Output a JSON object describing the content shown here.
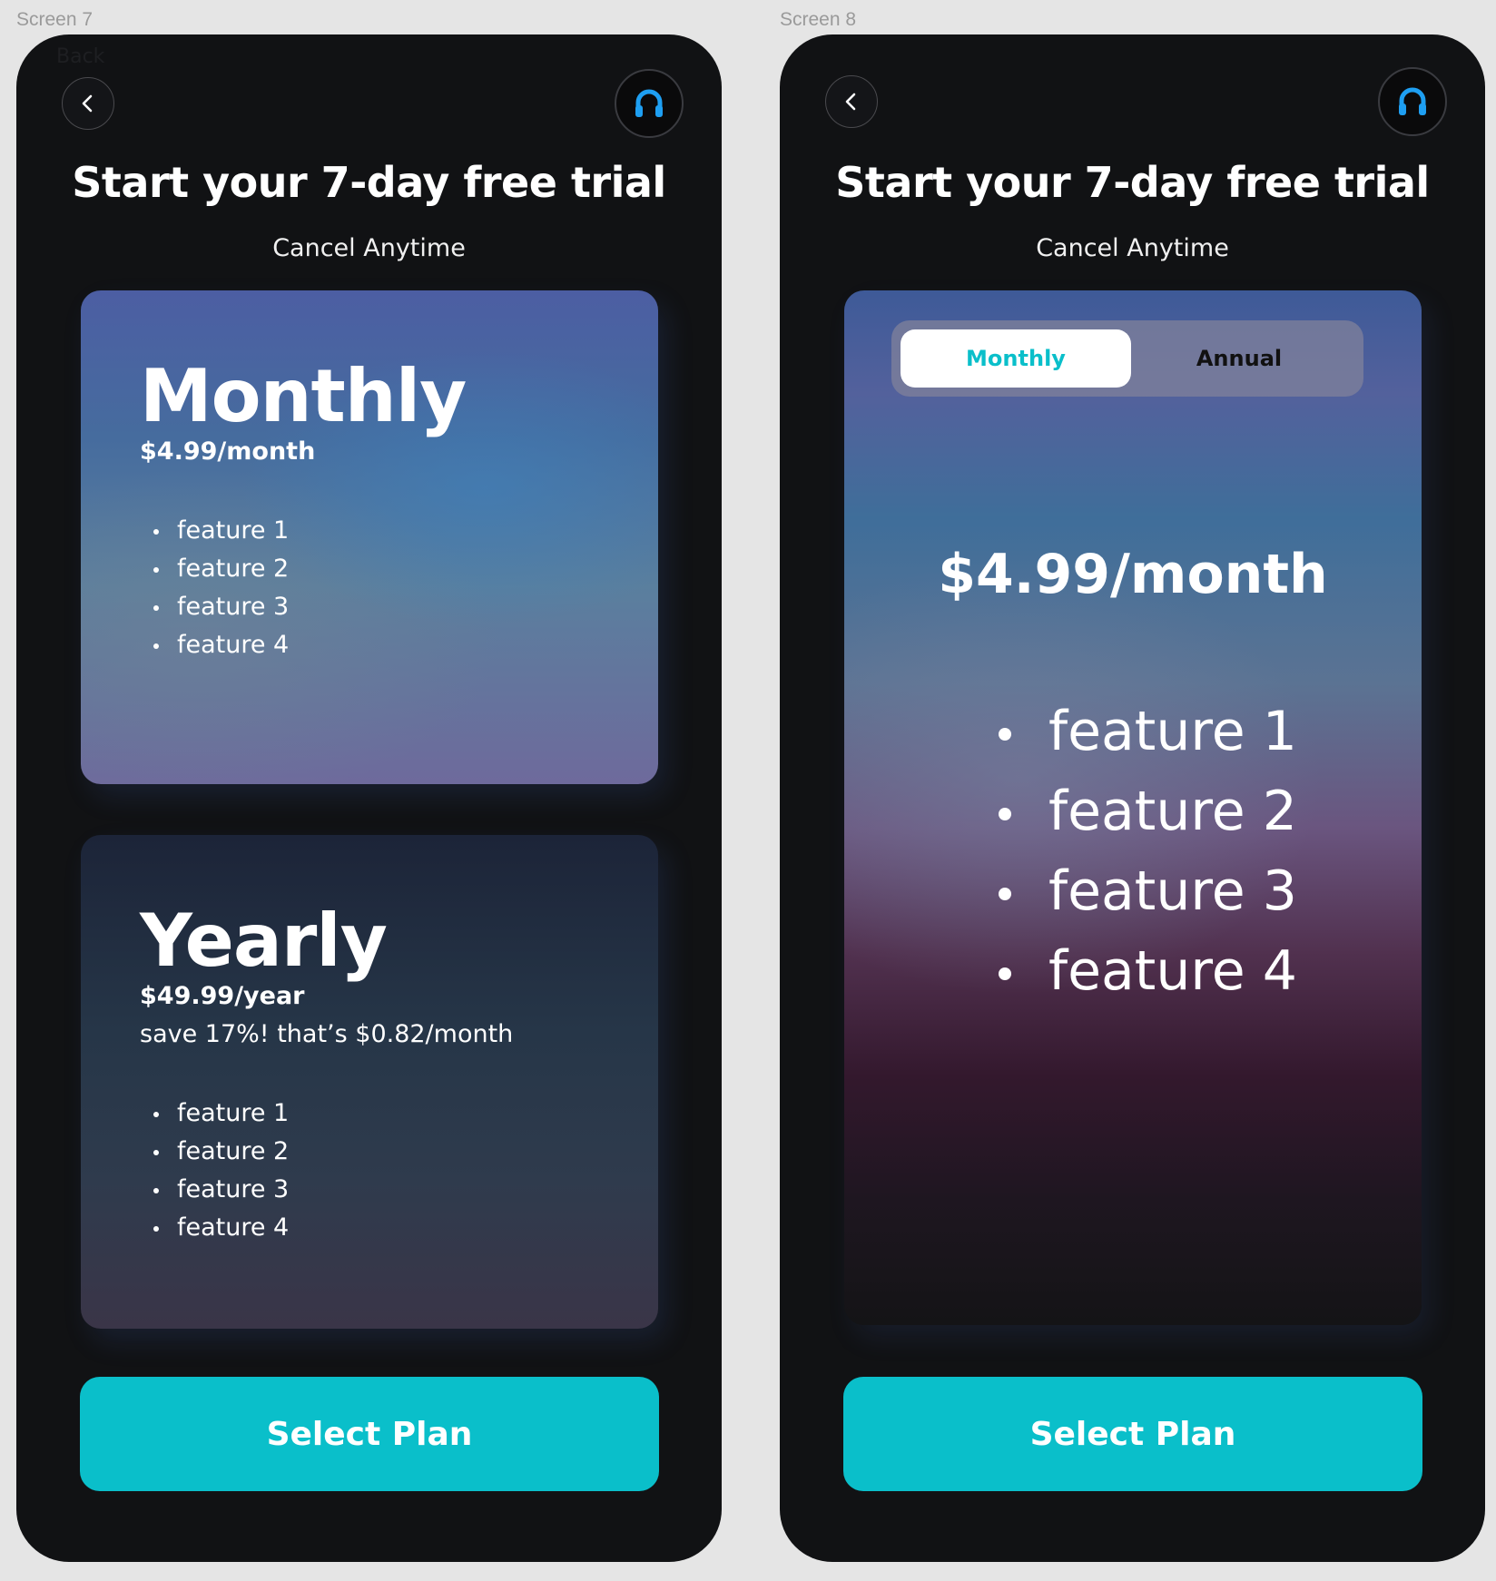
{
  "screens": [
    {
      "label": "Screen 7",
      "ghost_text": "Back",
      "title": "Start your 7-day free trial",
      "subtitle": "Cancel Anytime",
      "plans": [
        {
          "name": "Monthly",
          "price": "$4.99/month",
          "features": [
            "feature 1",
            "feature 2",
            "feature 3",
            "feature 4"
          ]
        },
        {
          "name": "Yearly",
          "price": "$49.99/year",
          "savings": "save 17%! that’s $0.82/month",
          "features": [
            "feature 1",
            "feature 2",
            "feature 3",
            "feature 4"
          ]
        }
      ],
      "cta": "Select Plan"
    },
    {
      "label": "Screen 8",
      "title": "Start your 7-day free trial",
      "subtitle": "Cancel Anytime",
      "toggle": {
        "monthly": "Monthly",
        "annual": "Annual",
        "selected": "Monthly"
      },
      "price": "$4.99/month",
      "features": [
        "feature 1",
        "feature 2",
        "feature 3",
        "feature 4"
      ],
      "cta": "Select Plan"
    }
  ],
  "colors": {
    "accent": "#0abfca",
    "help_icon": "#1e9ff2",
    "phone_bg": "#111214"
  },
  "icons": {
    "back": "chevron-left-icon",
    "help": "headset-icon"
  }
}
